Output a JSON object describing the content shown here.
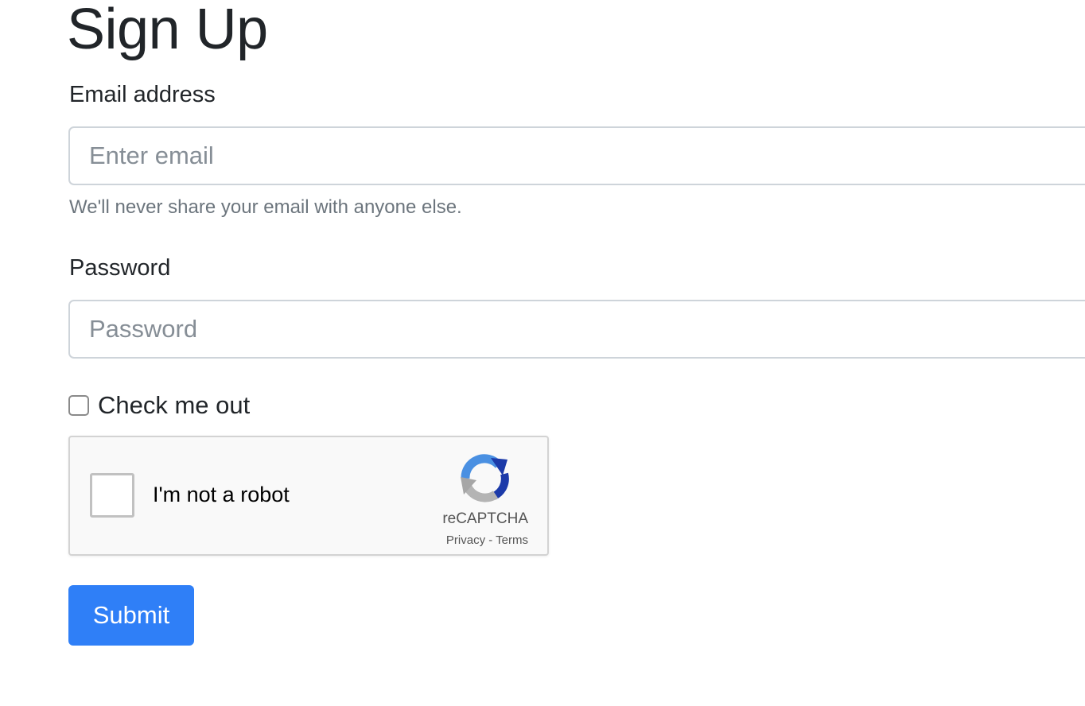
{
  "page": {
    "title": "Sign Up"
  },
  "form": {
    "email": {
      "label": "Email address",
      "placeholder": "Enter email",
      "value": "",
      "help": "We'll never share your email with anyone else."
    },
    "password": {
      "label": "Password",
      "placeholder": "Password",
      "value": ""
    },
    "checkbox": {
      "label": "Check me out",
      "checked": false
    },
    "recaptcha": {
      "prompt": "I'm not a robot",
      "brand": "reCAPTCHA",
      "privacy_label": "Privacy",
      "separator": " - ",
      "terms_label": "Terms",
      "icon": "recaptcha-logo-icon"
    },
    "submit_label": "Submit"
  },
  "colors": {
    "primary_button": "#2f7ff7",
    "text": "#212529",
    "muted_text": "#6c757d",
    "input_border": "#ced4da"
  }
}
